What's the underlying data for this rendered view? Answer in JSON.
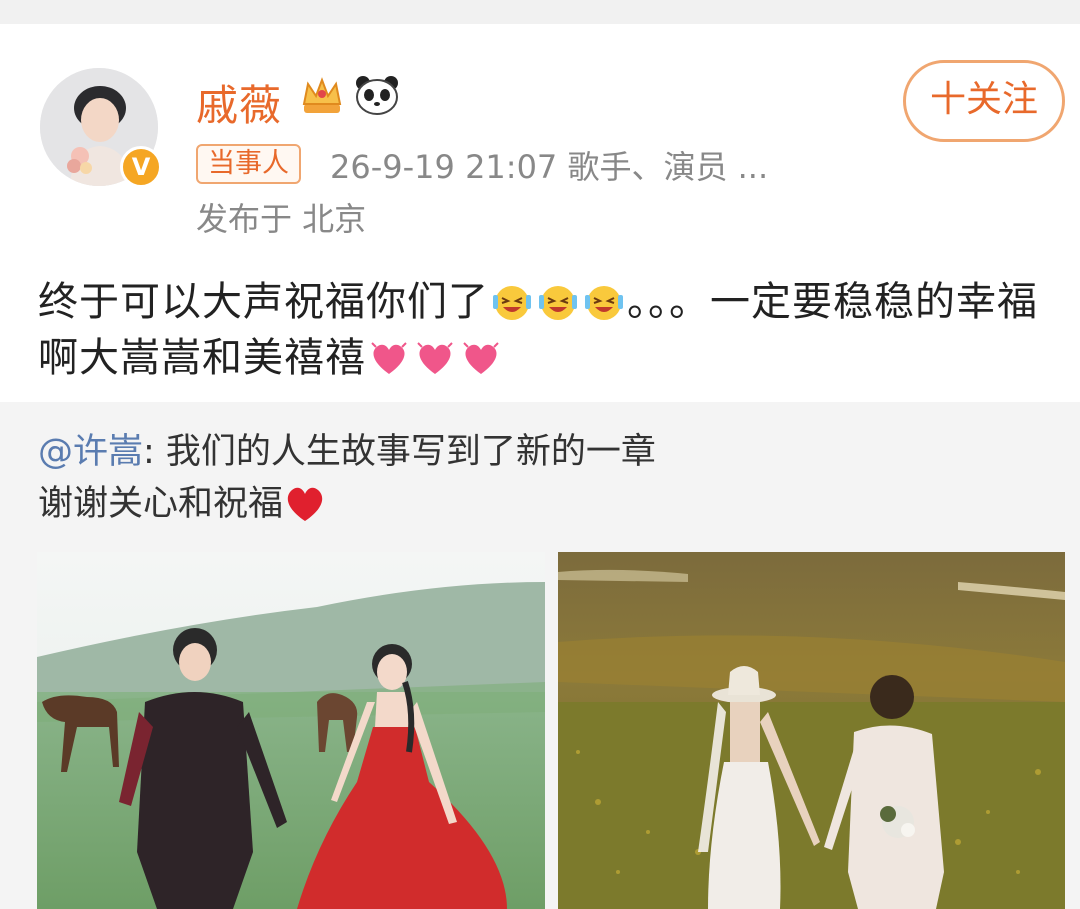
{
  "post": {
    "author": "戚薇",
    "verified_badge": "V",
    "tag": "当事人",
    "meta": "26-9-19 21:07  歌手、演员 ...",
    "location": "发布于 北京",
    "follow_label": "十关注",
    "text_part1": "终于可以大声祝福你们了",
    "text_part2": "。。。一定要稳稳的幸福啊大嵩嵩和美禧禧",
    "icons": [
      "crown-icon",
      "panda-icon",
      "laughing-crying-emoji",
      "heart-emoji"
    ]
  },
  "repost": {
    "mention": "@许嵩",
    "text": ": 我们的人生故事写到了新的一章",
    "text_line2": "谢谢关心和祝福"
  },
  "colors": {
    "accent": "#e8692b",
    "mention": "#5a7cb0",
    "repost_bg": "#f4f4f4"
  }
}
